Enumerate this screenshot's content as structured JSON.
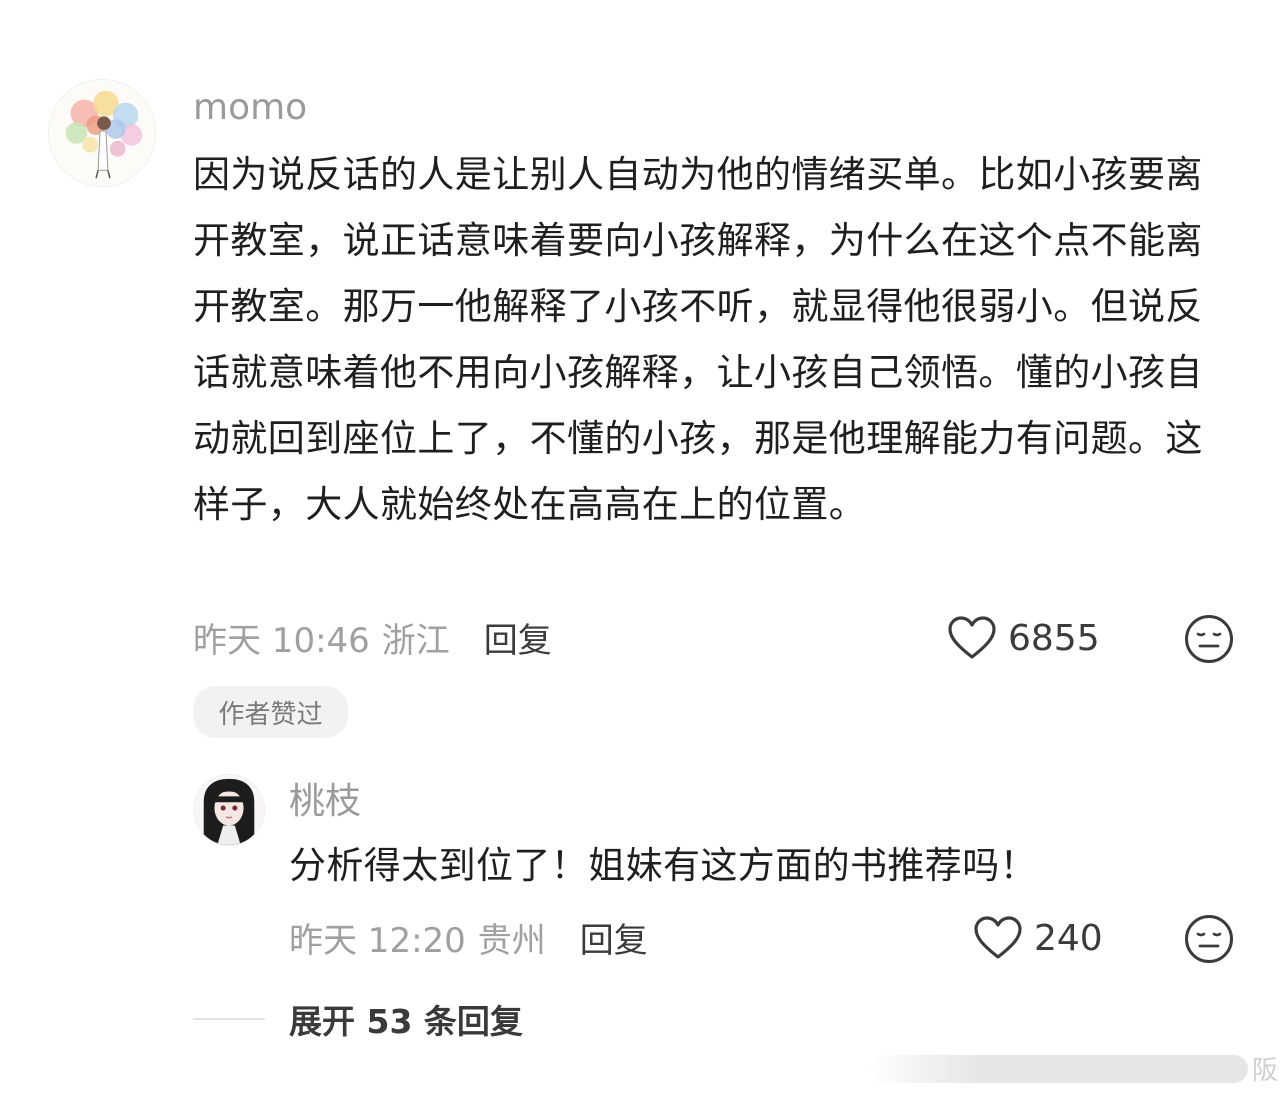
{
  "comments": [
    {
      "username": "momo",
      "text": "因为说反话的人是让别人自动为他的情绪买单。比如小孩要离开教室，说正话意味着要向小孩解释，为什么在这个点不能离开教室。那万一他解释了小孩不听，就显得他很弱小。但说反话就意味着他不用向小孩解释，让小孩自己领悟。懂的小孩自动就回到座位上了，不懂的小孩，那是他理解能力有问题。这样子，大人就始终处在高高在上的位置。",
      "time": "昨天 10:46",
      "location": "浙江",
      "reply_label": "回复",
      "likes": "6855",
      "badge": "作者赞过",
      "like_icon": "heart-outline-icon",
      "emoji_icon": "neutral-face-icon"
    }
  ],
  "replies": [
    {
      "username": "桃枝",
      "text": "分析得太到位了！姐妹有这方面的书推荐吗！",
      "time": "昨天 12:20",
      "location": "贵州",
      "reply_label": "回复",
      "likes": "240",
      "like_icon": "heart-outline-icon",
      "emoji_icon": "neutral-face-icon"
    }
  ],
  "expand_label": "展开 53 条回复",
  "watermark_glyph": "阪",
  "colors": {
    "text_primary": "#1f1f1f",
    "text_secondary": "#a0a0a0",
    "badge_bg": "#f2f2f2"
  }
}
